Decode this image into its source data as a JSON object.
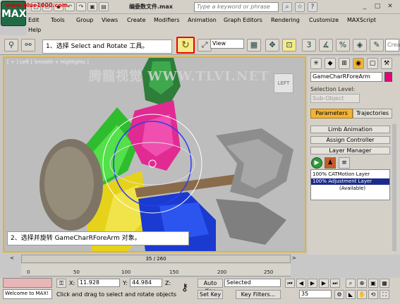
{
  "app": {
    "logo_text": "MAX",
    "watermark_url": "www.blue1000.com",
    "file_title": "编委数文件.max",
    "search_placeholder": "Type a keyword or phrase"
  },
  "menu": [
    "Edit",
    "Tools",
    "Group",
    "Views",
    "Create",
    "Modifiers",
    "Animation",
    "Graph Editors",
    "Rendering",
    "Customize",
    "MAXScript",
    "Help"
  ],
  "toolbar": {
    "view_select": "View",
    "callout_step1": "1、选择 Select and Rotate 工具。",
    "rotate_tool_icon": "rotate-icon"
  },
  "viewport": {
    "label": "[ + ] Left [ Smooth + Highlights ]",
    "watermark": "腾龍视觉 WWW.TLVI.NET",
    "viewcube_label": "LEFT",
    "callout_step2": "2、选择并旋转 GameCharRForeArm 对象。"
  },
  "panel": {
    "object_name": "GameCharRForeArm",
    "object_color": "#e6007e",
    "selection_level_label": "Selection Level:",
    "subobject_placeholder": "Sub-Object",
    "tab_parameters": "Parameters",
    "tab_trajectories": "Trajectories",
    "rollouts": [
      "Limb Animation",
      "Assign Controller",
      "Layer Manager"
    ],
    "layers": [
      "100% CATMotion Layer",
      "100% Adjustment Layer",
      "(Available)"
    ]
  },
  "timeline": {
    "frame_display": "35 / 260",
    "ticks": [
      "0",
      "50",
      "100",
      "150",
      "200",
      "250"
    ]
  },
  "status": {
    "welcome": "Welcome to MAX!",
    "hint": "Click and drag to select and rotate objects",
    "x_label": "X:",
    "x_value": "11.928",
    "y_label": "Y:",
    "y_value": "44.984",
    "z_label": "Z:",
    "z_value": "",
    "auto_key": "Auto Key",
    "set_key": "Set Key",
    "key_mode": "Selected",
    "key_filters": "Key Filters...",
    "current_frame": "35"
  }
}
